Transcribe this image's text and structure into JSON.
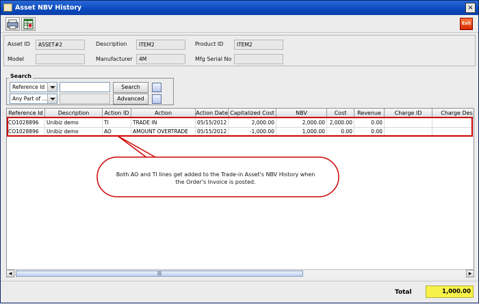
{
  "window": {
    "title": "Asset NBV History",
    "close_glyph": "×",
    "exit_label": "Exit"
  },
  "toolbar": {
    "print_icon": "printer-icon",
    "excel_icon": "spreadsheet-icon",
    "exit_icon": "exit-icon"
  },
  "info": {
    "asset_id_label": "Asset ID",
    "asset_id_value": "ASSET#2",
    "description_label": "Description",
    "description_value": "ITEM2",
    "product_id_label": "Product ID",
    "product_id_value": "ITEM2",
    "model_label": "Model",
    "model_value": "",
    "manufacturer_label": "Manufacturer",
    "manufacturer_value": "4M",
    "mfg_serial_label": "Mfg Serial No",
    "mfg_serial_value": ""
  },
  "search": {
    "legend": "Search",
    "field_combo": "Reference Id",
    "match_combo": "Any Part of ...",
    "search_button": "Search",
    "advanced_button": "Advanced"
  },
  "table": {
    "columns": [
      "Reference Id",
      "Description",
      "Action ID",
      "Action",
      "Action Date",
      "Capitalized Cost",
      "NBV",
      "Cost",
      "Revenue",
      "Charge ID",
      "Charge Des"
    ],
    "rows": [
      [
        "CO1028896",
        "Unibiz demo",
        "TI",
        "TRADE IN",
        "05/15/2012",
        "2,000.00",
        "2,000.00",
        "2,000.00",
        "0.00",
        "",
        ""
      ],
      [
        "CO1028896",
        "Unibiz demo",
        "AO",
        "AMOUNT OVERTRADE",
        "05/15/2012",
        "-1,000.00",
        "1,000.00",
        "0.00",
        "0.00",
        "",
        ""
      ]
    ]
  },
  "scrollbar": {
    "thumb_grip": "|||"
  },
  "callout": {
    "text": "Both AO and TI lines get added to the Trade-in Asset's NBV History when the Order's Invoice is posted.",
    "accent": "#cc0000"
  },
  "footer": {
    "total_label": "Total",
    "total_value": "1,000.00"
  }
}
